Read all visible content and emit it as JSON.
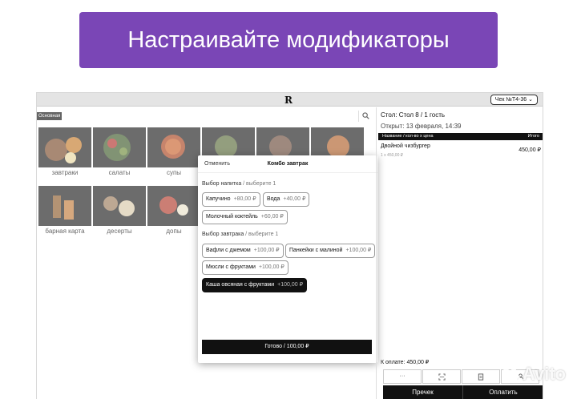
{
  "banner": {
    "text": "Настраивайте модификаторы"
  },
  "topbar": {
    "logo": "R",
    "check_label": "Чек №Т4-36"
  },
  "menu": {
    "category_tab": "Основная",
    "tiles": [
      {
        "label": "завтраки"
      },
      {
        "label": "салаты"
      },
      {
        "label": "супы"
      },
      {
        "label": ""
      },
      {
        "label": ""
      },
      {
        "label": ""
      },
      {
        "label": "барная карта"
      },
      {
        "label": "десерты"
      },
      {
        "label": "допы"
      }
    ]
  },
  "modal": {
    "cancel_label": "Отменить",
    "title": "Комбо завтрак",
    "drink_group": {
      "title": "Выбор напитка",
      "hint": "/ выберите 1"
    },
    "drinks": [
      {
        "name": "Капучино",
        "price": "+80,00 ₽"
      },
      {
        "name": "Вода",
        "price": "+40,00 ₽"
      },
      {
        "name": "Молочный коктейль",
        "price": "+60,00 ₽"
      }
    ],
    "breakfast_group": {
      "title": "Выбор завтрака",
      "hint": "/ выберите 1"
    },
    "breakfasts": [
      {
        "name": "Вафли с джемом",
        "price": "+100,00 ₽",
        "selected": false
      },
      {
        "name": "Панкейки с малиной",
        "price": "+100,00 ₽",
        "selected": false
      },
      {
        "name": "Мюсли с фруктами",
        "price": "+100,00 ₽",
        "selected": false
      },
      {
        "name": "Каша овсяная с фруктами",
        "price": "+100,00 ₽",
        "selected": true
      }
    ],
    "done_label": "Готово / 100,00 ₽"
  },
  "order": {
    "table": "Стол: Стол 8 / 1 гость",
    "opened": "Открыт: 13 февраля, 14:39",
    "header_left": "Название / кол-во х цена",
    "header_right": "Итого",
    "items": [
      {
        "name": "Двойной чизбургер",
        "qty_price": "1 х 450,00 ₽",
        "total": "450,00 ₽"
      }
    ],
    "to_pay": "К оплате: 450,00 ₽",
    "more_label": "···",
    "tab_check": "Пречек",
    "tab_pay": "Оплатить"
  },
  "watermark": {
    "text": "Avito"
  }
}
